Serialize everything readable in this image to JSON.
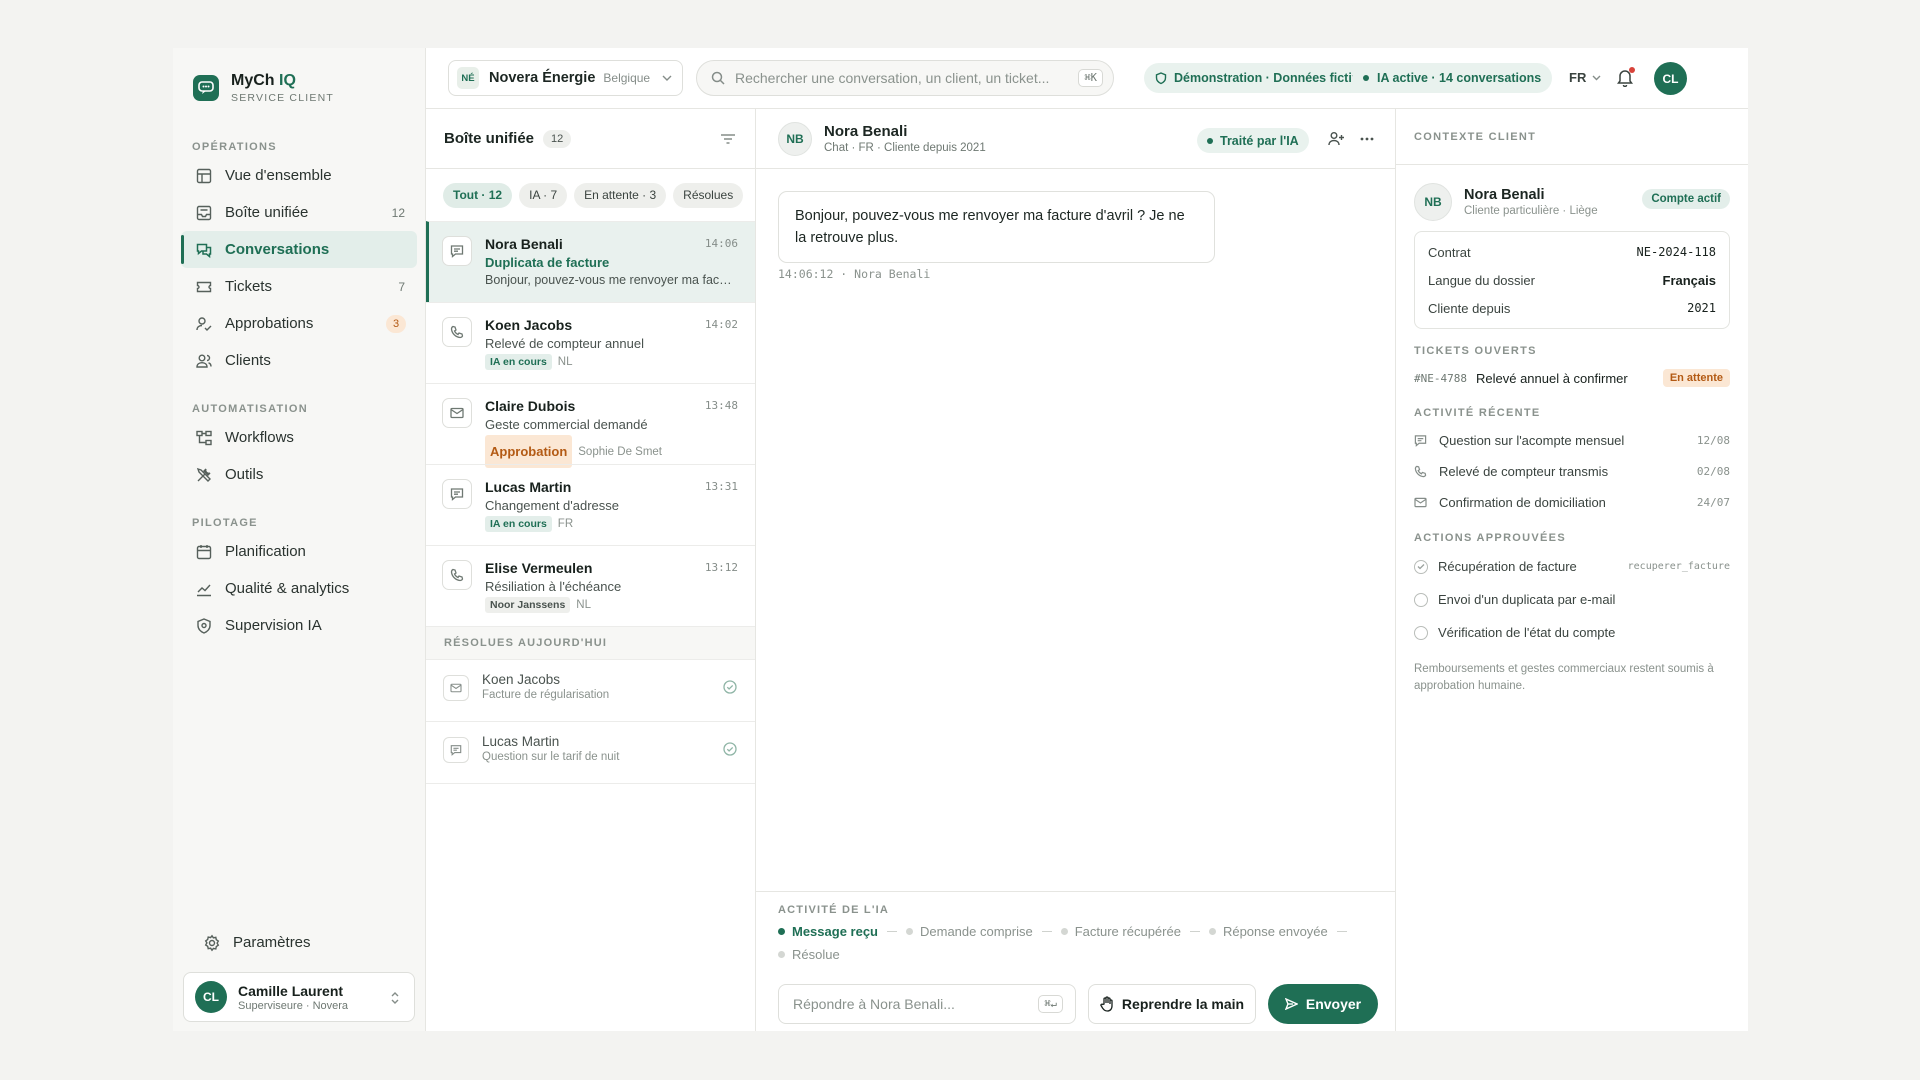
{
  "brand": {
    "name": "MyCh",
    "name_accent": "IQ",
    "subtitle": "SERVICE CLIENT"
  },
  "sidebar": {
    "sections": [
      {
        "label": "OPÉRATIONS"
      },
      {
        "label": "AUTOMATISATION"
      },
      {
        "label": "PILOTAGE"
      }
    ],
    "items": [
      {
        "label": "Vue d'ensemble",
        "icon": "layout-icon"
      },
      {
        "label": "Boîte unifiée",
        "count": "12",
        "icon": "inbox-icon"
      },
      {
        "label": "Conversations",
        "icon": "chat-icon",
        "active": true
      },
      {
        "label": "Tickets",
        "count": "7",
        "icon": "ticket-icon"
      },
      {
        "label": "Approbations",
        "count": "3",
        "icon": "approval-icon"
      },
      {
        "label": "Clients",
        "icon": "users-icon"
      },
      {
        "label": "Workflows",
        "icon": "workflow-icon"
      },
      {
        "label": "Outils",
        "icon": "tools-icon"
      },
      {
        "label": "Planification",
        "icon": "calendar-icon"
      },
      {
        "label": "Qualité & analytics",
        "icon": "analytics-icon"
      },
      {
        "label": "Supervision IA",
        "icon": "shield-icon"
      }
    ],
    "settings": "Paramètres",
    "user": {
      "initials": "CL",
      "name": "Camille Laurent",
      "role": "Superviseure · Novera"
    }
  },
  "topbar": {
    "org": {
      "tag": "NÉ",
      "name": "Novera Énergie",
      "country": "Belgique"
    },
    "search": {
      "placeholder": "Rechercher une conversation, un client, un ticket...",
      "shortcut": "⌘K"
    },
    "demo_pill": "Démonstration · Données fictives",
    "ai_pill": "IA active · 14 conversations",
    "lang": "FR",
    "avatar": "CL"
  },
  "inbox": {
    "title": "Boîte unifiée",
    "count": "12",
    "filters": [
      "Tout · 12",
      "IA · 7",
      "En attente · 3",
      "Résolues"
    ],
    "conversations": [
      {
        "name": "Nora Benali",
        "time": "14:06",
        "subject": "Duplicata de facture",
        "preview": "Bonjour, pouvez-vous me renvoyer ma facture d'avril ? Je ne la retrouve plus.",
        "channel": "chat"
      },
      {
        "name": "Koen Jacobs",
        "time": "14:02",
        "subject": "Relevé de compteur annuel",
        "tag": "IA en cours",
        "lang": "NL",
        "channel": "phone"
      },
      {
        "name": "Claire Dubois",
        "time": "13:48",
        "subject": "Geste commercial demandé",
        "tag": "Approbation",
        "lang": "Sophie De Smet",
        "channel": "email"
      },
      {
        "name": "Lucas Martin",
        "time": "13:31",
        "subject": "Changement d'adresse",
        "tag": "IA en cours",
        "lang": "FR",
        "channel": "chat"
      },
      {
        "name": "Elise Vermeulen",
        "time": "13:12",
        "subject": "Résiliation à l'échéance",
        "tag": "Noor Janssens",
        "lang": "NL",
        "channel": "phone"
      }
    ],
    "resolved_label": "RÉSOLUES AUJOURD'HUI",
    "resolved": [
      {
        "name": "Koen Jacobs",
        "subject": "Facture de régularisation",
        "channel": "email"
      },
      {
        "name": "Lucas Martin",
        "subject": "Question sur le tarif de nuit",
        "channel": "chat"
      }
    ]
  },
  "chat": {
    "initials": "NB",
    "name": "Nora Benali",
    "meta": "Chat · FR · Cliente depuis 2021",
    "status": "Traité par l'IA",
    "message": "Bonjour, pouvez-vous me renvoyer ma facture d'avril ? Je ne la retrouve plus.",
    "message_meta": "14:06:12 · Nora Benali",
    "activity_label": "ACTIVITÉ DE L'IA",
    "steps": [
      "Message reçu",
      "Demande comprise",
      "Facture récupérée",
      "Réponse envoyée",
      "Résolue"
    ],
    "reply_placeholder": "Répondre à Nora Benali...",
    "reply_shortcut": "⌘↵",
    "takeover": "Reprendre la main",
    "send": "Envoyer"
  },
  "context": {
    "title": "CONTEXTE CLIENT",
    "customer": {
      "initials": "NB",
      "name": "Nora Benali",
      "sub": "Cliente particulière · Liège",
      "badge": "Compte actif"
    },
    "fields": [
      {
        "label": "Contrat",
        "value": "NE-2024-118"
      },
      {
        "label": "Langue du dossier",
        "value": "Français"
      },
      {
        "label": "Cliente depuis",
        "value": "2021"
      }
    ],
    "tickets_label": "TICKETS OUVERTS",
    "ticket": {
      "id": "#NE-4788",
      "title": "Relevé annuel à confirmer",
      "status": "En attente"
    },
    "activity_label": "ACTIVITÉ RÉCENTE",
    "activity": [
      {
        "text": "Question sur l'acompte mensuel",
        "date": "12/08",
        "icon": "message-icon"
      },
      {
        "text": "Relevé de compteur transmis",
        "date": "02/08",
        "icon": "phone-icon"
      },
      {
        "text": "Confirmation de domiciliation",
        "date": "24/07",
        "icon": "mail-icon"
      }
    ],
    "actions_label": "ACTIONS APPROUVÉES",
    "actions": [
      {
        "text": "Récupération de facture",
        "tool": "recuperer_facture",
        "done": true
      },
      {
        "text": "Envoi d'un duplicata par e-mail",
        "tool": "",
        "done": false
      },
      {
        "text": "Vérification de l'état du compte",
        "tool": "",
        "done": false
      }
    ],
    "note": "Remboursements et gestes commerciaux restent soumis à approbation humaine."
  },
  "colors": {
    "accent": "#1f6f55",
    "warning": "#b35a14",
    "warning_bg": "#fbe7d4"
  }
}
